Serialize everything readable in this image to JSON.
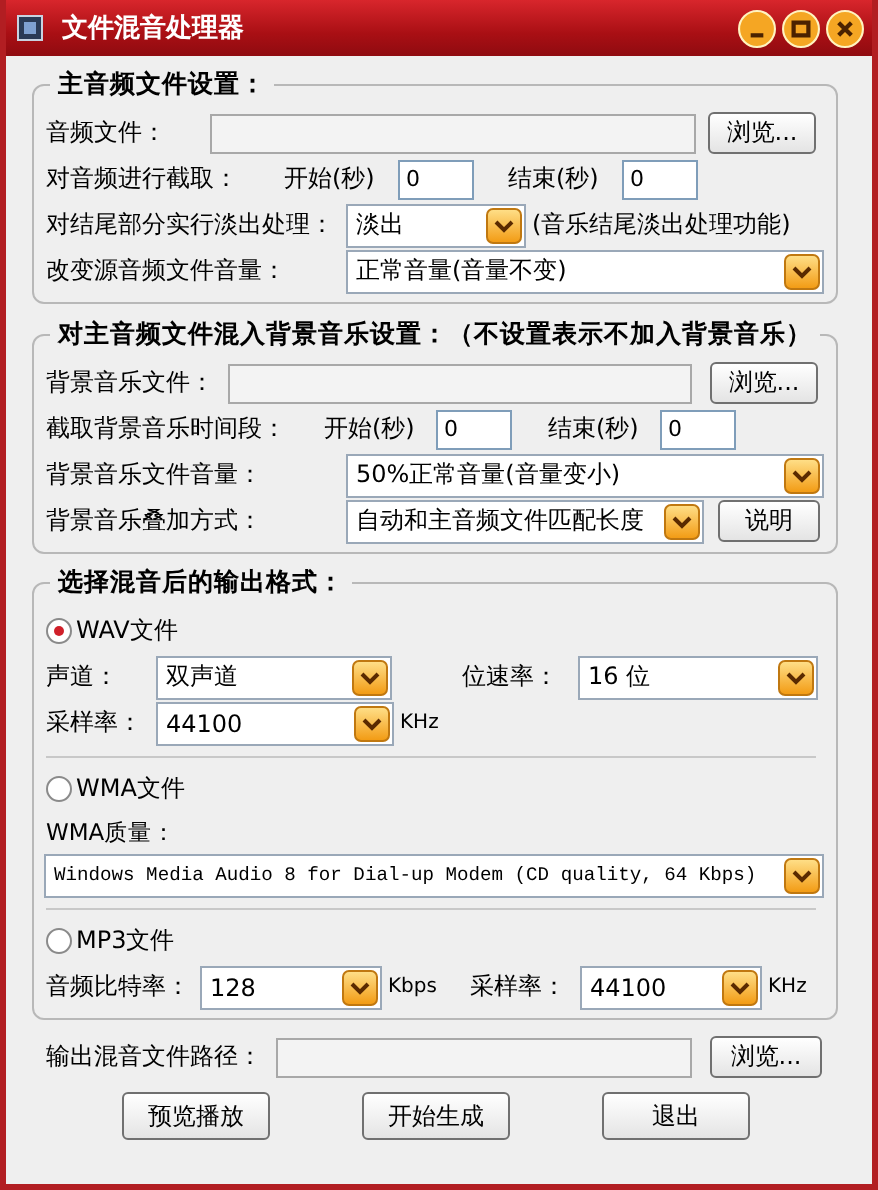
{
  "window": {
    "title": "文件混音处理器"
  },
  "main_audio": {
    "title": "主音频文件设置：",
    "file_label": "音频文件：",
    "browse": "浏览...",
    "trim_label": "对音频进行截取：",
    "start_label": "开始(秒)",
    "start_value": "0",
    "end_label": "结束(秒)",
    "end_value": "0",
    "fade_label": "对结尾部分实行淡出处理：",
    "fade_value": "淡出",
    "fade_note": "(音乐结尾淡出处理功能)",
    "volume_label": "改变源音频文件音量：",
    "volume_value": "正常音量(音量不变)"
  },
  "background_music": {
    "title": "对主音频文件混入背景音乐设置：（不设置表示不加入背景音乐）",
    "file_label": "背景音乐文件：",
    "browse": "浏览...",
    "trim_label": "截取背景音乐时间段：",
    "start_label": "开始(秒)",
    "start_value": "0",
    "end_label": "结束(秒)",
    "end_value": "0",
    "volume_label": "背景音乐文件音量：",
    "volume_value": "50%正常音量(音量变小)",
    "mode_label": "背景音乐叠加方式：",
    "mode_value": "自动和主音频文件匹配长度",
    "help_button": "说明"
  },
  "output_format": {
    "title": "选择混音后的输出格式：",
    "formats": [
      {
        "kind": "wav",
        "label": "WAV文件",
        "selected": true,
        "channel_label": "声道：",
        "channel_value": "双声道",
        "bits_label": "位速率：",
        "bits_value": "16 位",
        "rate_label": "采样率：",
        "rate_value": "44100",
        "rate_unit": "KHz"
      },
      {
        "kind": "wma",
        "label": "WMA文件",
        "selected": false,
        "quality_label": "WMA质量：",
        "quality_value": "Windows Media Audio 8 for Dial-up Modem (CD quality, 64 Kbps)"
      },
      {
        "kind": "mp3",
        "label": "MP3文件",
        "selected": false,
        "bitrate_label": "音频比特率：",
        "bitrate_value": "128",
        "bitrate_unit": "Kbps",
        "rate_label": "采样率：",
        "rate_value": "44100",
        "rate_unit": "KHz"
      }
    ]
  },
  "output_path": {
    "label": "输出混音文件路径：",
    "browse": "浏览..."
  },
  "buttons": [
    "预览播放",
    "开始生成",
    "退出"
  ]
}
